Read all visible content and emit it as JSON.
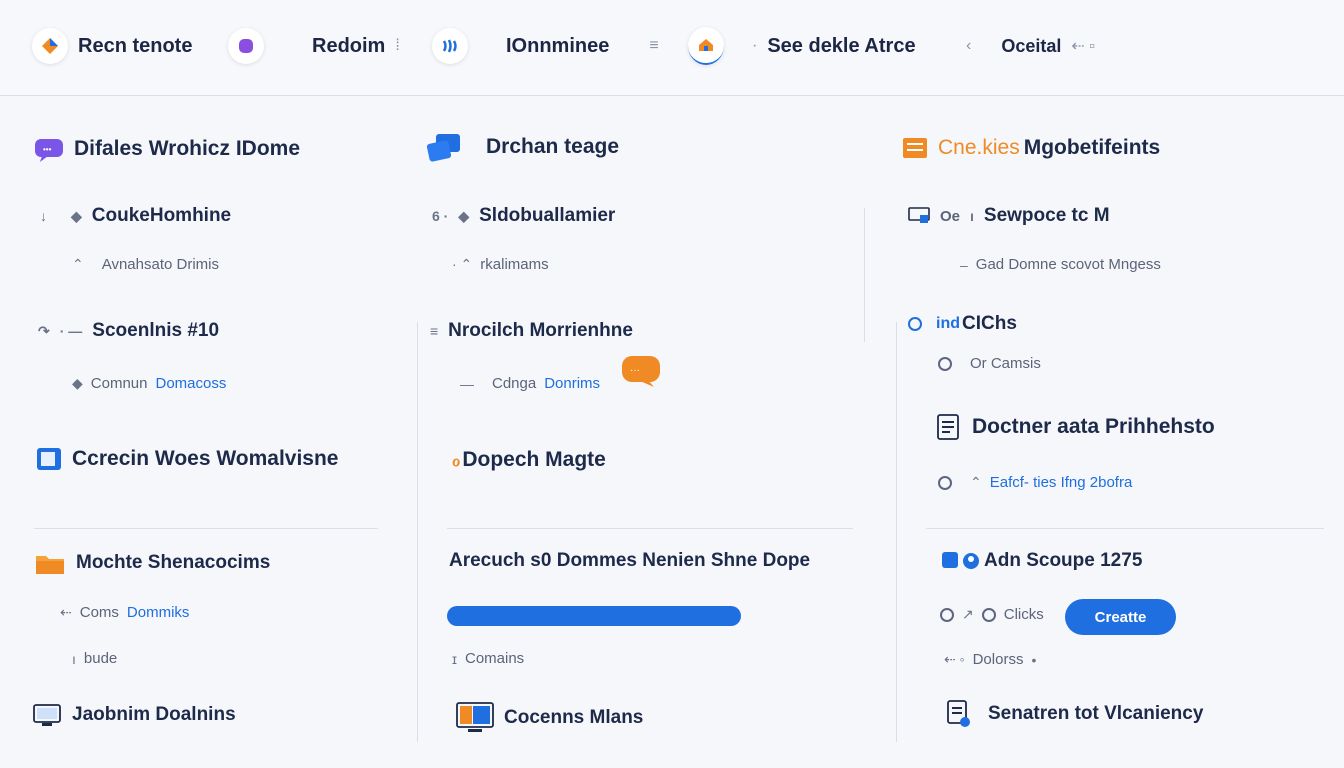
{
  "topbar": {
    "items": [
      {
        "label": "Recn tenote",
        "icon": "kite-icon"
      },
      {
        "label": "",
        "icon": "purple-badge-icon"
      },
      {
        "label": "Redoim",
        "icon": ""
      },
      {
        "label": "",
        "icon": "wave-icon"
      },
      {
        "label": "IOnnminee",
        "icon": ""
      },
      {
        "label": "",
        "icon": "house-icon"
      },
      {
        "label": "See dekle Atrce",
        "icon": ""
      },
      {
        "label": "Oceital",
        "icon": ""
      }
    ]
  },
  "col1": {
    "header": "Difales Wrohicz IDome",
    "item1": {
      "title": "CoukeHomhine",
      "meta": "Avnahsato Drimis"
    },
    "item2": {
      "title": "Scoenlnis #10",
      "meta_prefix": "Comnun",
      "meta_link": "Domacoss"
    },
    "item3": {
      "title": "Ccrecin Woes Womalvisne"
    },
    "item4": {
      "title": "Mochte Shenacocims",
      "meta_prefix": "Coms",
      "meta_link": "Dommiks",
      "meta2": "bude"
    },
    "item5": {
      "title": "Jaobnim Doalnins"
    }
  },
  "col2": {
    "header": "Drchan teage",
    "item1": {
      "title": "Sldobuallamier",
      "meta": "rkalimams"
    },
    "item2": {
      "title": "Nrocilch Morrienhne",
      "meta_prefix": "Cdnga",
      "meta_link": "Donrims"
    },
    "item3": {
      "title": "Dopech Magte"
    },
    "item4": {
      "title": "Arecuch s0 Dommes  Nenien Shne Dope",
      "progress": 0.5,
      "meta": "Comains"
    },
    "item5": {
      "title": "Cocenns Mlans"
    }
  },
  "col3": {
    "header_accent": "Cne.kies",
    "header": "Mgobetifeints",
    "item1": {
      "prefix": "Oe",
      "title": "Sewpoce tc M",
      "meta": "Gad Domne scovot Mngess"
    },
    "item2": {
      "prefix": "ind",
      "title": "CIChs",
      "meta": "Or Camsis"
    },
    "item3": {
      "title": "Doctner aata Prihhehsto",
      "meta": "Eafcf- ties Ifng 2bofra"
    },
    "item4": {
      "title": "Adn Scoupe 1275",
      "meta": "Clicks",
      "button": "Creatte",
      "meta2": "Dolorss"
    },
    "item5": {
      "title": "Senatren tot Vlcaniency"
    }
  },
  "colors": {
    "accent": "#1f6fe0",
    "orange": "#f08a24",
    "purple": "#7b55e8",
    "text": "#1e2a4a"
  }
}
